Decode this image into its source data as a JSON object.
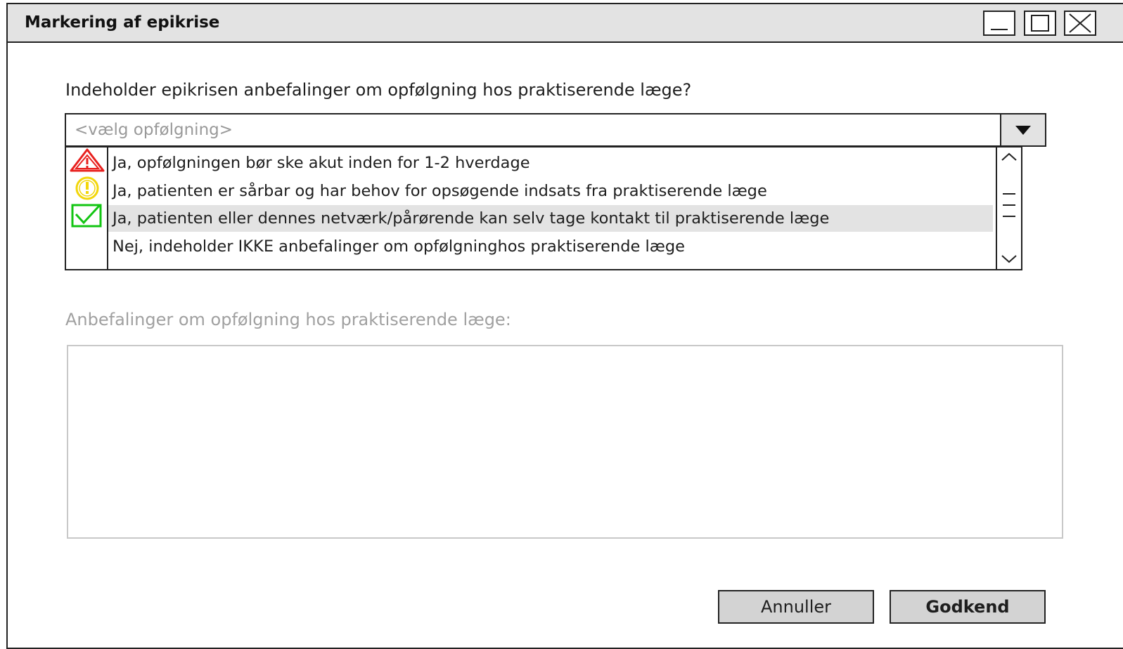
{
  "window": {
    "title": "Markering af epikrise",
    "controls": [
      "minimize-icon",
      "maximize-icon",
      "close-icon"
    ]
  },
  "question": "Indeholder epikrisen anbefalinger om opfølgning hos praktiserende læge?",
  "combo": {
    "placeholder": "<vælg opfølgning>",
    "arrow_icon": "triangle-down-icon"
  },
  "options": [
    {
      "label": "Ja, opfølgningen bør ske akut inden for 1-2 hverdage",
      "icon": "warning-triangle-icon",
      "color": "#e8201e"
    },
    {
      "label": "Ja, patienten er sårbar og har behov for opsøgende indsats fra praktiserende læge",
      "icon": "exclamation-circle-icon",
      "color": "#f2d60b"
    },
    {
      "label": "Ja, patienten eller dennes netværk/pårørende kan selv tage kontakt til praktiserende læge",
      "icon": "checkbox-check-icon",
      "color": "#13c513",
      "highlighted": true
    },
    {
      "label": "Nej, indeholder IKKE anbefalinger om opfølgninghos praktiserende læge",
      "icon": "",
      "color": ""
    }
  ],
  "recommendations": {
    "label": "Anbefalinger om opfølgning hos praktiserende læge:",
    "value": ""
  },
  "buttons": {
    "cancel": "Annuller",
    "ok": "Godkend"
  },
  "colors": {
    "titlebar": "#e3e3e3",
    "highlight": "#e3e3e3",
    "button": "#d3d3d3",
    "disabled_text": "#a0a0a0"
  }
}
